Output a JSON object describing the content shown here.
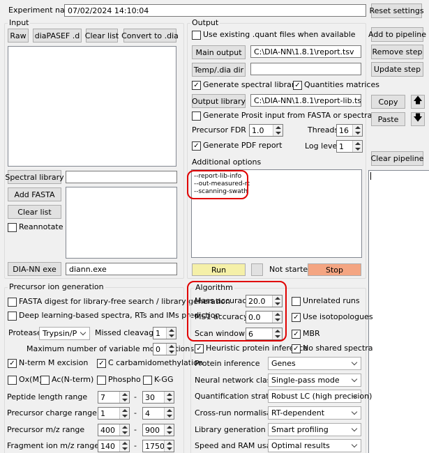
{
  "experiment": {
    "label": "Experiment name:",
    "value": "07/02/2024 14:10:04",
    "reset": "Reset settings"
  },
  "input": {
    "title": "Input",
    "raw": "Raw",
    "diapasef": "diaPASEF .d",
    "clear_list": "Clear list",
    "convert": "Convert to .dia",
    "spectral_library": "Spectral library",
    "spectral_library_path": "",
    "add_fasta": "Add FASTA",
    "clear_list_fasta": "Clear list",
    "reannotate": "Reannotate",
    "reannotate_checked": false,
    "diann_exe": "DIA-NN exe",
    "diann_exe_value": "diann.exe"
  },
  "output": {
    "title": "Output",
    "use_existing": "Use existing .quant files when available",
    "use_existing_checked": false,
    "main_output": "Main output",
    "main_output_value": "C:\\DIA-NN\\1.8.1\\report.tsv",
    "temp_dir": "Temp/.dia dir",
    "temp_dir_value": "",
    "gen_lib": "Generate spectral library",
    "gen_lib_checked": true,
    "quant_mat": "Quantities matrices",
    "quant_mat_checked": true,
    "output_library": "Output library",
    "output_library_value": "C:\\DIA-NN\\1.8.1\\report-lib.tsv",
    "prosit": "Generate Prosit input from FASTA or spectral library",
    "prosit_checked": false,
    "fdr_label": "Precursor FDR (%)",
    "fdr_value": "1.0",
    "threads_label": "Threads",
    "threads_value": "16",
    "pdf": "Generate PDF report",
    "pdf_checked": true,
    "log_label": "Log level",
    "log_value": "1"
  },
  "additional": {
    "title": "Additional options",
    "lines": [
      "--report-lib-info",
      "--out-measured-rt",
      "--scanning-swath"
    ]
  },
  "run": {
    "run": "Run",
    "status": "Not started",
    "stop": "Stop"
  },
  "pipeline": {
    "add": "Add to pipeline",
    "remove": "Remove step",
    "update": "Update step",
    "copy": "Copy",
    "paste": "Paste",
    "clear": "Clear pipeline",
    "log_text": ""
  },
  "precursor": {
    "title": "Precursor ion generation",
    "fasta_digest": "FASTA digest for library-free search / library generation",
    "fasta_digest_checked": false,
    "deep_learning": "Deep learning-based spectra, RTs and IMs prediction",
    "deep_learning_checked": false,
    "protease_label": "Protease",
    "protease_value": "Trypsin/P",
    "missed_label": "Missed cleavages",
    "missed_value": "1",
    "max_var_label": "Maximum number of variable modifications",
    "max_var_value": "0",
    "nterm": "N-term M excision",
    "nterm_checked": true,
    "ccarb": "C carbamidomethylation",
    "ccarb_checked": true,
    "ox": "Ox(M)",
    "ox_checked": false,
    "ac": "Ac(N-term)",
    "ac_checked": false,
    "phospho": "Phospho",
    "phospho_checked": false,
    "kgg": "K-GG",
    "kgg_checked": false,
    "ranges": [
      {
        "label": "Peptide length range",
        "min": "7",
        "max": "30"
      },
      {
        "label": "Precursor charge range",
        "min": "1",
        "max": "4"
      },
      {
        "label": "Precursor m/z range",
        "min": "400",
        "max": "900"
      },
      {
        "label": "Fragment ion m/z range",
        "min": "140",
        "max": "1750"
      }
    ],
    "dash": "-"
  },
  "algorithm": {
    "title": "Algorithm",
    "mass_acc_label": "Mass accuracy",
    "mass_acc_value": "20.0",
    "ms1_label": "MS1 accuracy",
    "ms1_value": "0.0",
    "scan_label": "Scan window",
    "scan_value": "6",
    "unrelated": "Unrelated runs",
    "unrelated_checked": false,
    "isotopologues": "Use isotopologues",
    "isotopologues_checked": true,
    "mbr": "MBR",
    "mbr_checked": true,
    "heuristic": "Heuristic protein inference",
    "heuristic_checked": true,
    "no_shared": "No shared spectra",
    "no_shared_checked": true,
    "dropdowns": [
      {
        "label": "Protein inference",
        "value": "Genes"
      },
      {
        "label": "Neural network classifier",
        "value": "Single-pass mode"
      },
      {
        "label": "Quantification strategy",
        "value": "Robust LC (high precision)"
      },
      {
        "label": "Cross-run normalisation",
        "value": "RT-dependent"
      },
      {
        "label": "Library generation",
        "value": "Smart profiling"
      },
      {
        "label": "Speed and RAM usage",
        "value": "Optimal results"
      }
    ]
  },
  "colors": {
    "run": "#f5f0a8",
    "stop": "#f4a582",
    "highlight": "#e00000"
  }
}
